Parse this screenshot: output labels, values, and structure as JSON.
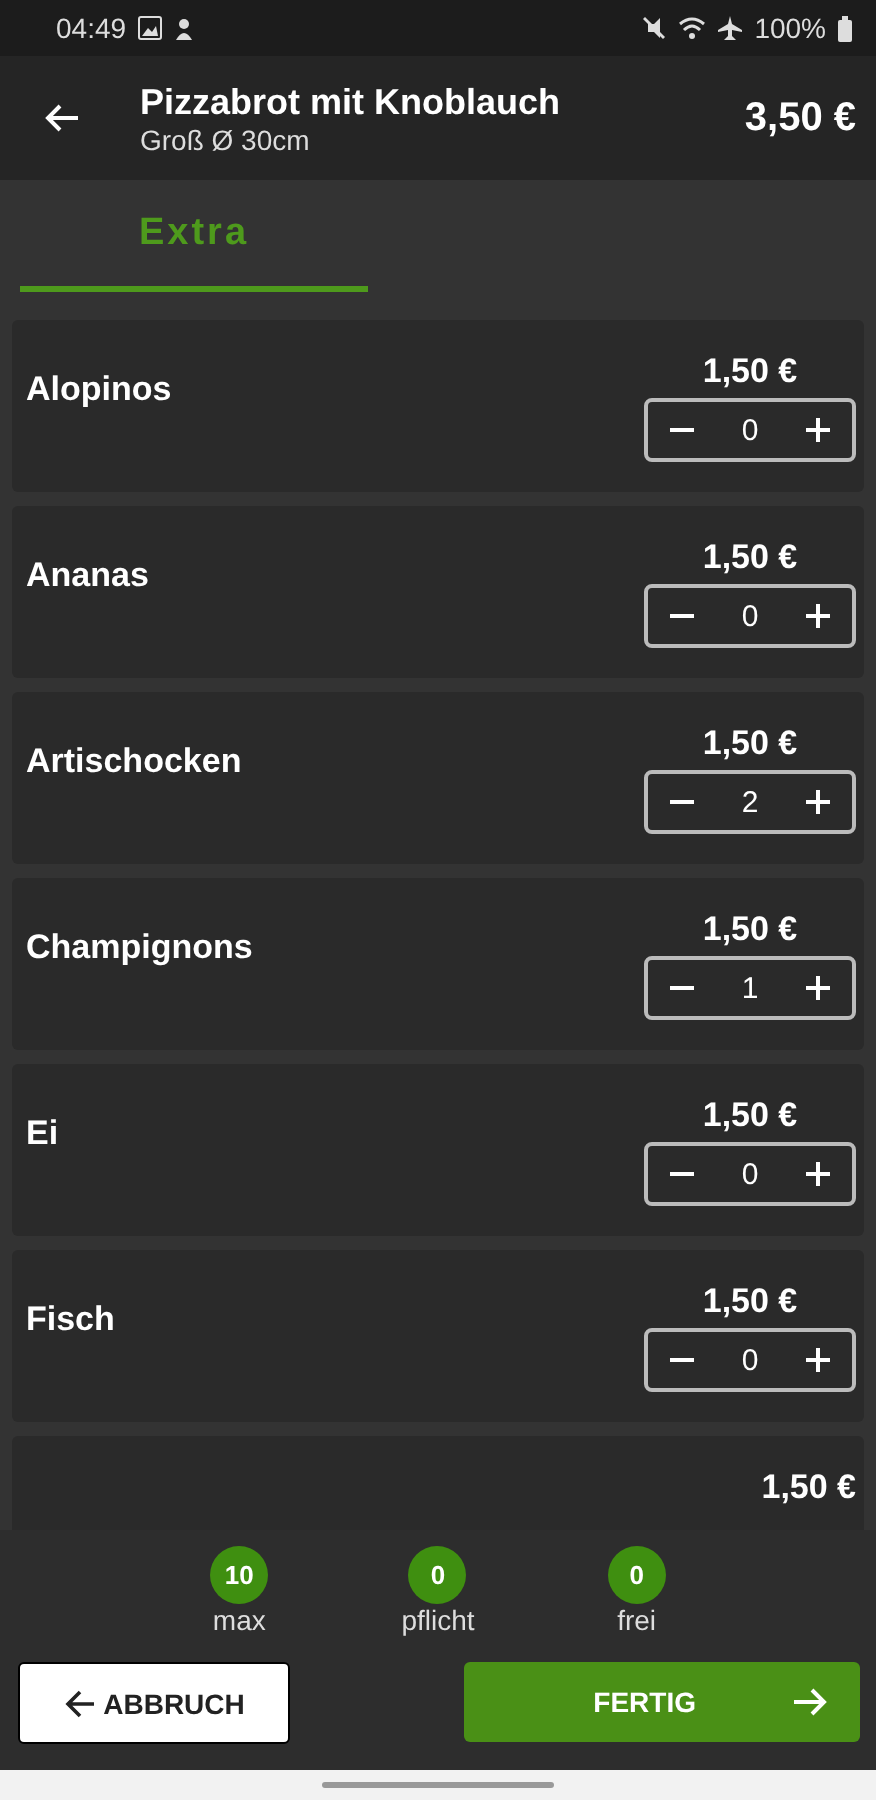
{
  "status_bar": {
    "time": "04:49",
    "battery": "100%"
  },
  "header": {
    "title": "Pizzabrot mit Knoblauch",
    "subtitle": "Groß Ø 30cm",
    "price": "3,50 €"
  },
  "tabs": [
    {
      "label": "Extra",
      "selected": true
    }
  ],
  "items": [
    {
      "name": "Alopinos",
      "price": "1,50 €",
      "quantity": "0"
    },
    {
      "name": "Ananas",
      "price": "1,50 €",
      "quantity": "0"
    },
    {
      "name": "Artischocken",
      "price": "1,50 €",
      "quantity": "2"
    },
    {
      "name": "Champignons",
      "price": "1,50 €",
      "quantity": "1"
    },
    {
      "name": "Ei",
      "price": "1,50 €",
      "quantity": "0"
    },
    {
      "name": "Fisch",
      "price": "1,50 €",
      "quantity": "0"
    },
    {
      "price": "1,50 €"
    }
  ],
  "counters": [
    {
      "value": "10",
      "label": "max"
    },
    {
      "value": "0",
      "label": "pflicht"
    },
    {
      "value": "0",
      "label": "frei"
    }
  ],
  "buttons": {
    "cancel": "ABBRUCH",
    "done": "FERTIG"
  }
}
